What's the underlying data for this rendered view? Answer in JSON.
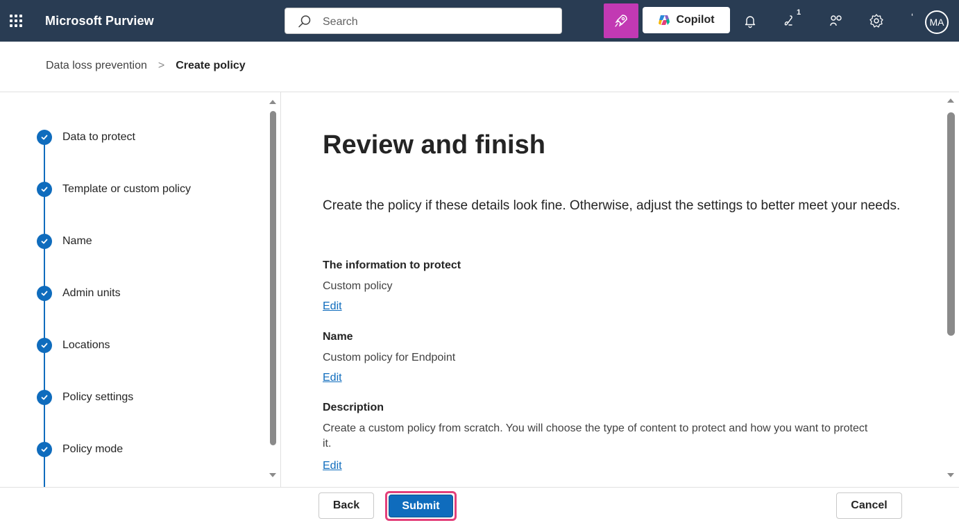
{
  "app": {
    "title": "Microsoft Purview"
  },
  "header": {
    "search_placeholder": "Search",
    "copilot_label": "Copilot",
    "notification_badge": "1",
    "avatar_initials": "MA",
    "tick": "‘",
    "colors": {
      "bar": "#293c53",
      "rocket": "#c239b3"
    },
    "icons": [
      "app-launcher-icon",
      "search-icon",
      "rocket-icon",
      "copilot-icon",
      "bell-icon",
      "help-icon",
      "connections-icon",
      "settings-icon"
    ]
  },
  "breadcrumb": {
    "parent": "Data loss prevention",
    "separator": ">",
    "current": "Create policy"
  },
  "steps": [
    {
      "label": "Data to protect",
      "status": "completed"
    },
    {
      "label": "Template or custom policy",
      "status": "completed"
    },
    {
      "label": "Name",
      "status": "completed"
    },
    {
      "label": "Admin units",
      "status": "completed"
    },
    {
      "label": "Locations",
      "status": "completed"
    },
    {
      "label": "Policy settings",
      "status": "completed"
    },
    {
      "label": "Policy mode",
      "status": "completed"
    }
  ],
  "main": {
    "title": "Review and finish",
    "intro": "Create the policy if these details look fine. Otherwise, adjust the settings to better meet your needs.",
    "sections": [
      {
        "heading": "The information to protect",
        "value": "Custom policy",
        "edit": "Edit"
      },
      {
        "heading": "Name",
        "value": "Custom policy for Endpoint",
        "edit": "Edit"
      },
      {
        "heading": "Description",
        "value": "Create a custom policy from scratch. You will choose the type of content to protect and how you want to protect it.",
        "edit": "Edit"
      }
    ]
  },
  "footer": {
    "back": "Back",
    "submit": "Submit",
    "cancel": "Cancel",
    "colors": {
      "primary": "#0f6cbd",
      "highlight": "#e3407a"
    }
  }
}
